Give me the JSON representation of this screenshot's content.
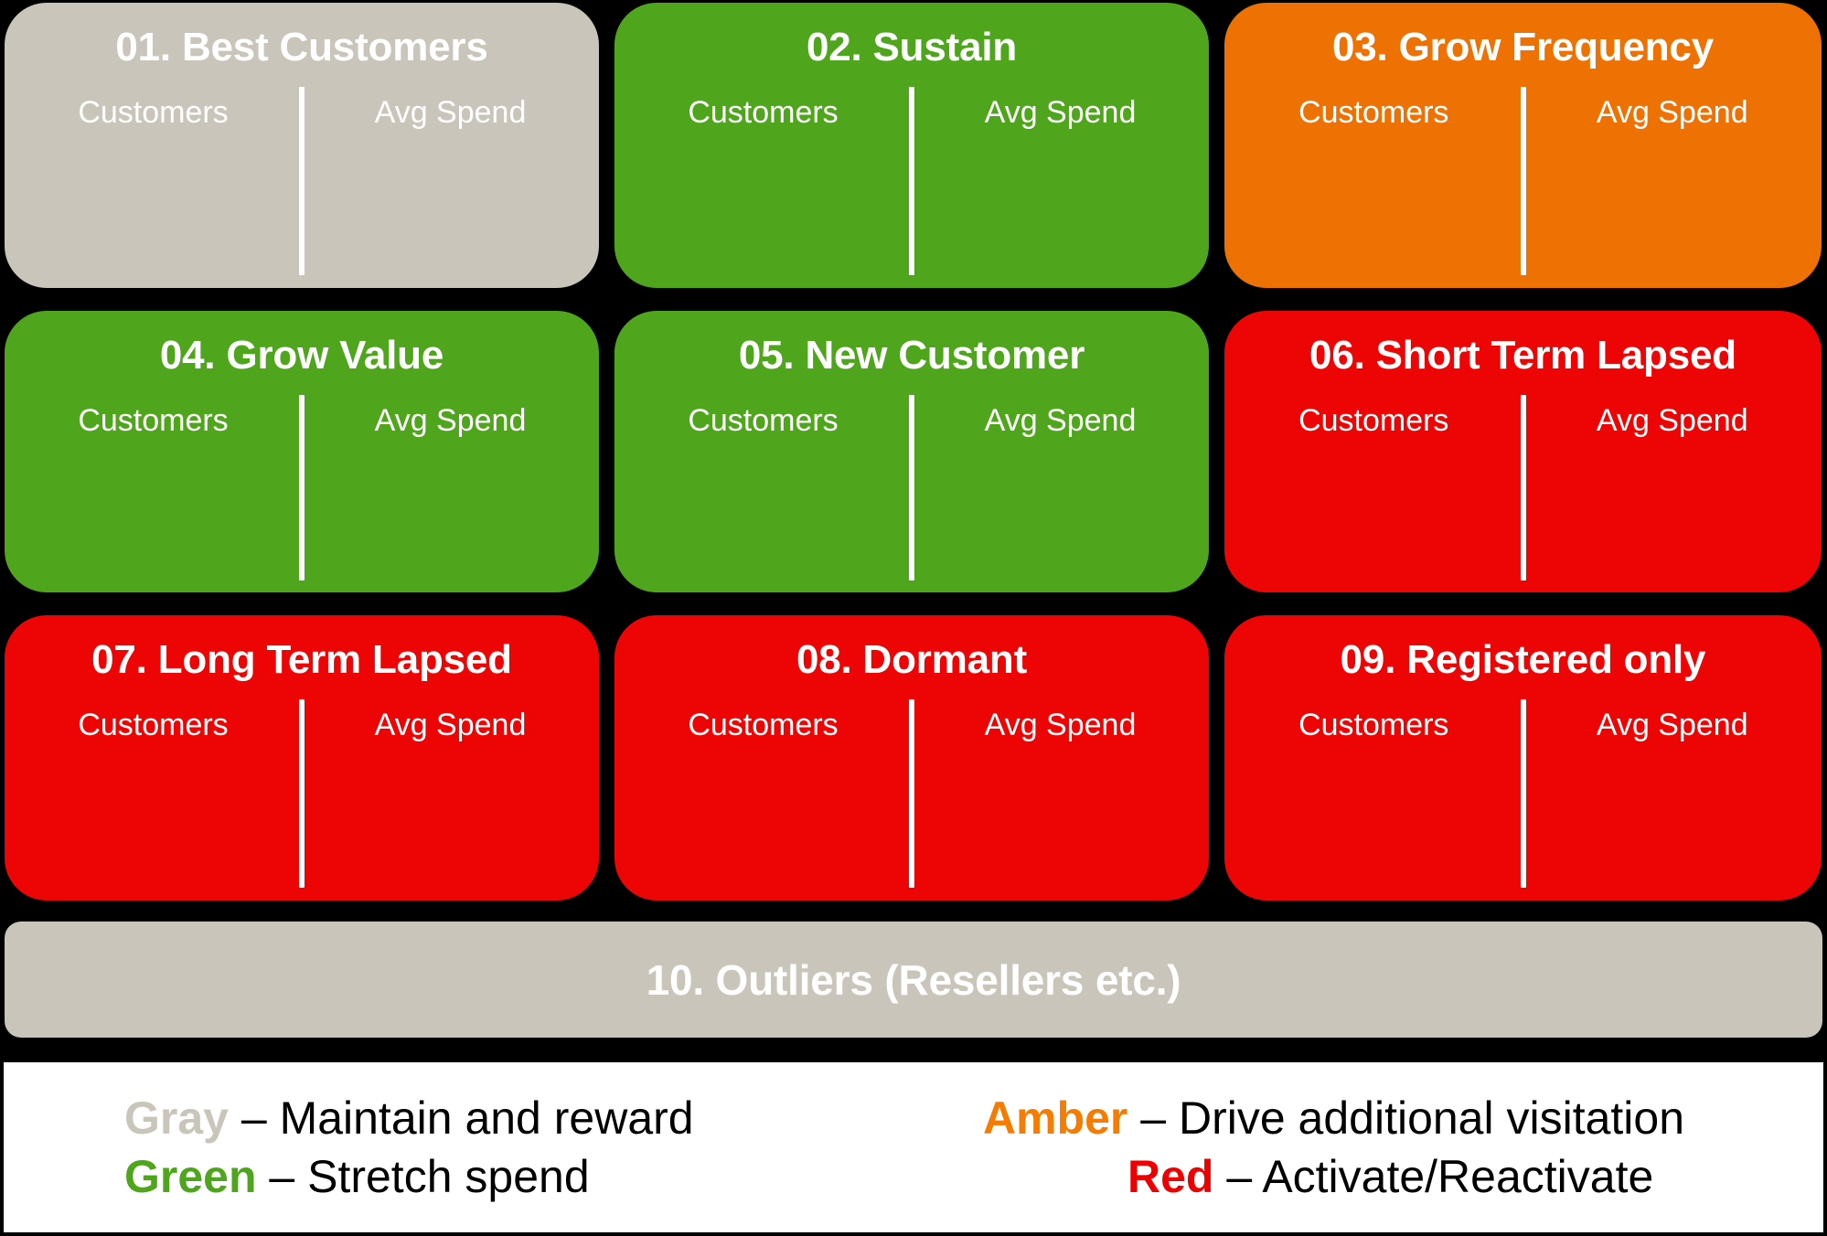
{
  "colors": {
    "gray": "#c9c5ba",
    "green": "#4fa61d",
    "amber": "#ee7203",
    "red": "#ed0404",
    "background": "#000000",
    "legend_background": "#ffffff",
    "text_on_card": "#ffffff",
    "legend_text": "#000000",
    "legend_amber_text": "#f57c00",
    "legend_red_text": "#ee0000"
  },
  "metric_labels": {
    "customers": "Customers",
    "avg_spend": "Avg Spend"
  },
  "cards": [
    {
      "title": "01. Best Customers",
      "color": "gray",
      "metric_left": "Customers",
      "metric_right": "Avg Spend"
    },
    {
      "title": "02. Sustain",
      "color": "green",
      "metric_left": "Customers",
      "metric_right": "Avg Spend"
    },
    {
      "title": "03. Grow Frequency",
      "color": "amber",
      "metric_left": "Customers",
      "metric_right": "Avg Spend"
    },
    {
      "title": "04. Grow Value",
      "color": "green",
      "metric_left": "Customers",
      "metric_right": "Avg Spend"
    },
    {
      "title": "05. New Customer",
      "color": "green",
      "metric_left": "Customers",
      "metric_right": "Avg Spend"
    },
    {
      "title": "06. Short Term Lapsed",
      "color": "red",
      "metric_left": "Customers",
      "metric_right": "Avg Spend"
    },
    {
      "title": "07. Long Term Lapsed",
      "color": "red",
      "metric_left": "Customers",
      "metric_right": "Avg Spend"
    },
    {
      "title": "08. Dormant",
      "color": "red",
      "metric_left": "Customers",
      "metric_right": "Avg Spend"
    },
    {
      "title": "09. Registered only",
      "color": "red",
      "metric_left": "Customers",
      "metric_right": "Avg Spend"
    }
  ],
  "outliers": {
    "title": "10. Outliers (Resellers etc.)",
    "color": "gray"
  },
  "legend": {
    "left": [
      {
        "key": "Gray",
        "separator": " – ",
        "text": "Maintain and reward",
        "key_color": "gray"
      },
      {
        "key": "Green",
        "separator": " – ",
        "text": "Stretch spend",
        "key_color": "green"
      }
    ],
    "right": [
      {
        "key": "Amber",
        "separator": " – ",
        "text": "Drive additional visitation",
        "key_color": "amber"
      },
      {
        "key": "Red",
        "separator": " – ",
        "text": "Activate/Reactivate",
        "key_color": "red"
      }
    ]
  }
}
